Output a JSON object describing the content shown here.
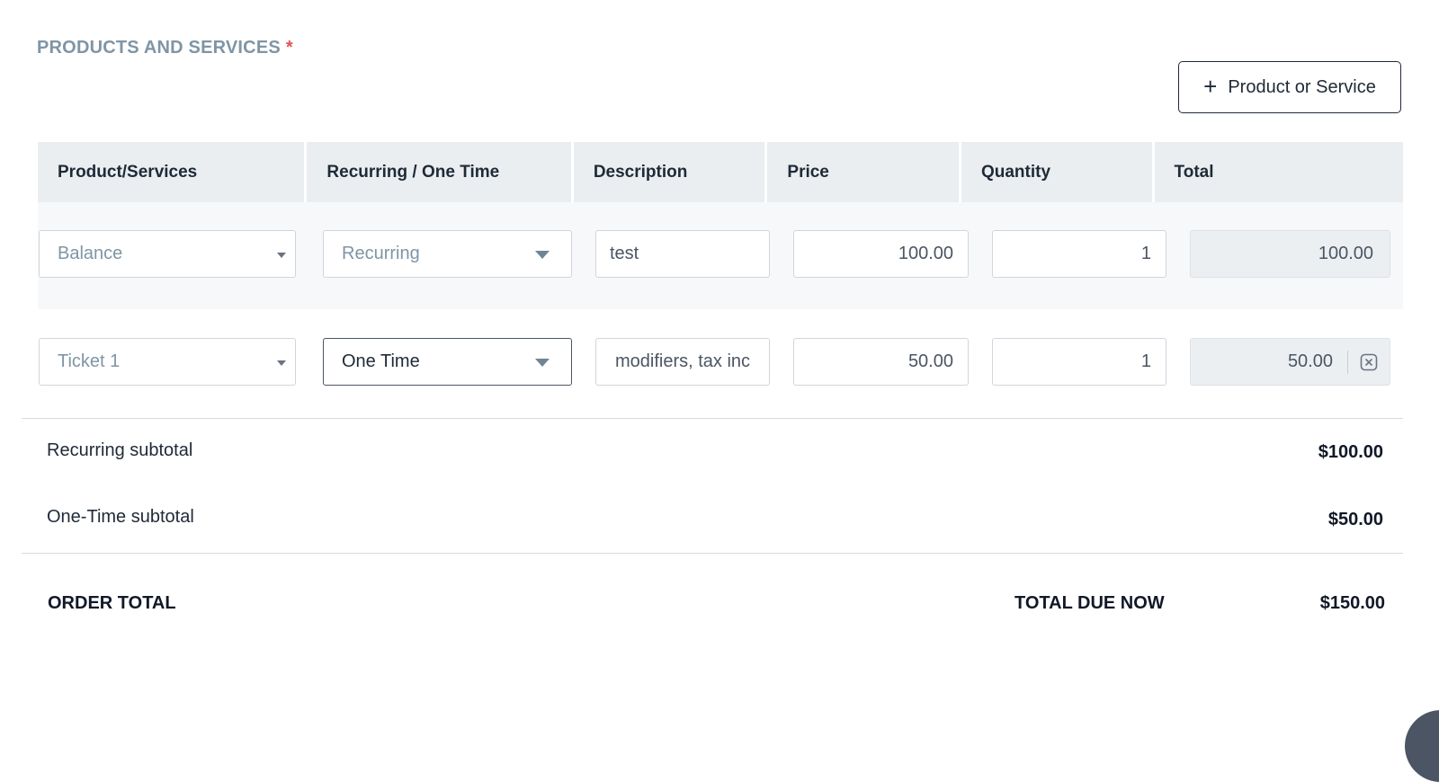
{
  "section": {
    "title": "PRODUCTS AND SERVICES",
    "required_mark": "*"
  },
  "add_button": {
    "label": "Product or Service",
    "icon": "plus-icon"
  },
  "table": {
    "headers": [
      "Product/Services",
      "Recurring / One Time",
      "Description",
      "Price",
      "Quantity",
      "Total"
    ],
    "rows": [
      {
        "product": "Balance",
        "billing": "Recurring",
        "description": "test",
        "price": "100.00",
        "quantity": "1",
        "total": "100.00"
      },
      {
        "product": "Ticket 1",
        "billing": "One Time",
        "description": "modifiers, tax inc",
        "price": "50.00",
        "quantity": "1",
        "total": "50.00",
        "remove_icon": "close-box-icon"
      }
    ]
  },
  "summary": {
    "recurring_label": "Recurring subtotal",
    "recurring_value": "$100.00",
    "onetime_label": "One-Time subtotal",
    "onetime_value": "$50.00",
    "order_total_label": "ORDER TOTAL",
    "total_due_label": "TOTAL DUE NOW",
    "total_due_value": "$150.00"
  },
  "colors": {
    "header_bg": "#eaeef1",
    "section_title": "#7f95a5",
    "required": "#e15454",
    "disabled_total_bg": "#eceff2"
  }
}
